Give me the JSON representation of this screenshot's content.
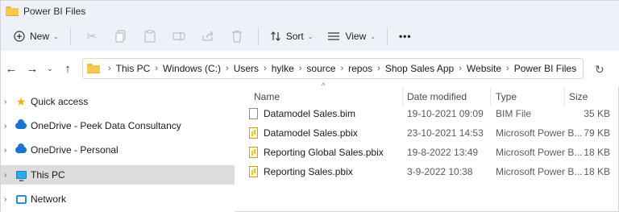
{
  "window": {
    "title": "Power BI Files"
  },
  "toolbar": {
    "new_label": "New",
    "sort_label": "Sort",
    "view_label": "View",
    "more_label": "•••"
  },
  "address": {
    "crumbs": [
      "This PC",
      "Windows (C:)",
      "Users",
      "hylke",
      "source",
      "repos",
      "Shop Sales App",
      "Website",
      "Power BI Files"
    ]
  },
  "nav": {
    "items": [
      {
        "label": "Quick access",
        "icon": "star-icon"
      },
      {
        "label": "OneDrive - Peek Data Consultancy",
        "icon": "cloud-icon"
      },
      {
        "label": "OneDrive - Personal",
        "icon": "cloud-icon"
      },
      {
        "label": "This PC",
        "icon": "computer-icon",
        "selected": true
      },
      {
        "label": "Network",
        "icon": "network-icon"
      }
    ]
  },
  "columns": {
    "name": "Name",
    "date": "Date modified",
    "type": "Type",
    "size": "Size"
  },
  "files": [
    {
      "name": "Datamodel Sales.bim",
      "date": "19-10-2021 09:09",
      "type": "BIM File",
      "size": "35 KB",
      "icon": "bim-file-icon"
    },
    {
      "name": "Datamodel Sales.pbix",
      "date": "23-10-2021 14:53",
      "type": "Microsoft Power B...",
      "size": "79 KB",
      "icon": "pbix-file-icon"
    },
    {
      "name": "Reporting Global Sales.pbix",
      "date": "19-8-2022 13:49",
      "type": "Microsoft Power B...",
      "size": "18 KB",
      "icon": "pbix-file-icon"
    },
    {
      "name": "Reporting Sales.pbix",
      "date": "3-9-2022 10:38",
      "type": "Microsoft Power B...",
      "size": "18 KB",
      "icon": "pbix-file-icon"
    }
  ]
}
